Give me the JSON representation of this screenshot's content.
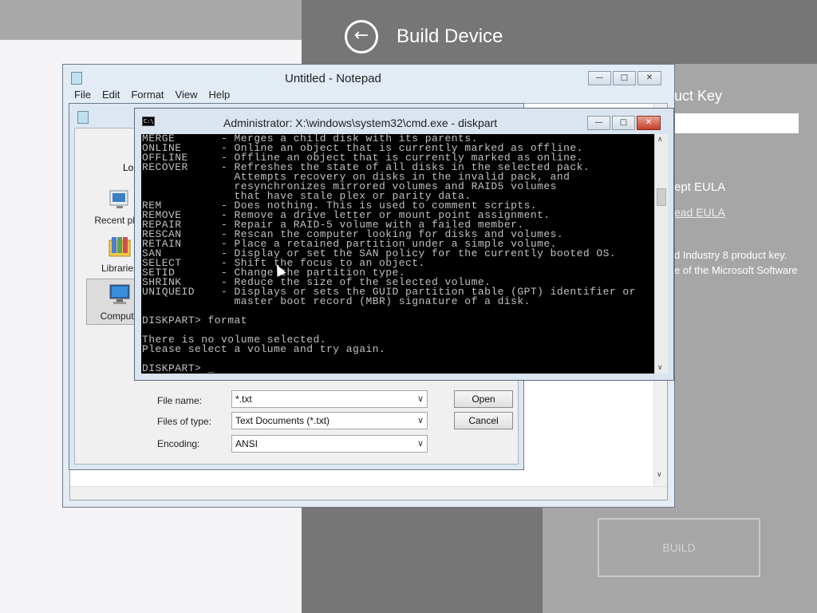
{
  "app": {
    "title": "Build Device",
    "back_icon": "←",
    "product_key_label": "uct Key",
    "accept_eula": "ept EULA",
    "read_eula": "ead EULA",
    "info_line1": "d Industry 8 product key.",
    "info_line2": "e of the Microsoft Software",
    "build_button": "BUILD"
  },
  "notepad": {
    "title": "Untitled - Notepad",
    "menu": [
      "File",
      "Edit",
      "Format",
      "View",
      "Help"
    ]
  },
  "save_dialog": {
    "look_label": "Look",
    "sidebar": [
      {
        "label": "Recent plac",
        "icon": "recent-places-icon"
      },
      {
        "label": "Libraries",
        "icon": "libraries-icon"
      },
      {
        "label": "Compute",
        "icon": "computer-icon"
      }
    ],
    "file_name_label": "File name:",
    "file_name_value": "*.txt",
    "files_of_type_label": "Files of type:",
    "files_of_type_value": "Text Documents (*.txt)",
    "encoding_label": "Encoding:",
    "encoding_value": "ANSI",
    "open_button": "Open",
    "cancel_button": "Cancel"
  },
  "cmd": {
    "title": "Administrator: X:\\windows\\system32\\cmd.exe - diskpart",
    "icon_text": "C:\\.",
    "lines": [
      "MERGE       - Merges a child disk with its parents.",
      "ONLINE      - Online an object that is currently marked as offline.",
      "OFFLINE     - Offline an object that is currently marked as online.",
      "RECOVER     - Refreshes the state of all disks in the selected pack.",
      "              Attempts recovery on disks in the invalid pack, and",
      "              resynchronizes mirrored volumes and RAID5 volumes",
      "              that have stale plex or parity data.",
      "REM         - Does nothing. This is used to comment scripts.",
      "REMOVE      - Remove a drive letter or mount point assignment.",
      "REPAIR      - Repair a RAID-5 volume with a failed member.",
      "RESCAN      - Rescan the computer looking for disks and volumes.",
      "RETAIN      - Place a retained partition under a simple volume.",
      "SAN         - Display or set the SAN policy for the currently booted OS.",
      "SELECT      - Shift the focus to an object.",
      "SETID       - Change the partition type.",
      "SHRINK      - Reduce the size of the selected volume.",
      "UNIQUEID    - Displays or sets the GUID partition table (GPT) identifier or",
      "              master boot record (MBR) signature of a disk.",
      "",
      "DISKPART> format",
      "",
      "There is no volume selected.",
      "Please select a volume and try again.",
      "",
      "DISKPART> _"
    ]
  },
  "window_controls": {
    "minimize": "—",
    "maximize": "□",
    "close": "✕"
  },
  "scroll_icons": {
    "up": "∧",
    "down": "∨"
  },
  "combo_arrow": "∨"
}
